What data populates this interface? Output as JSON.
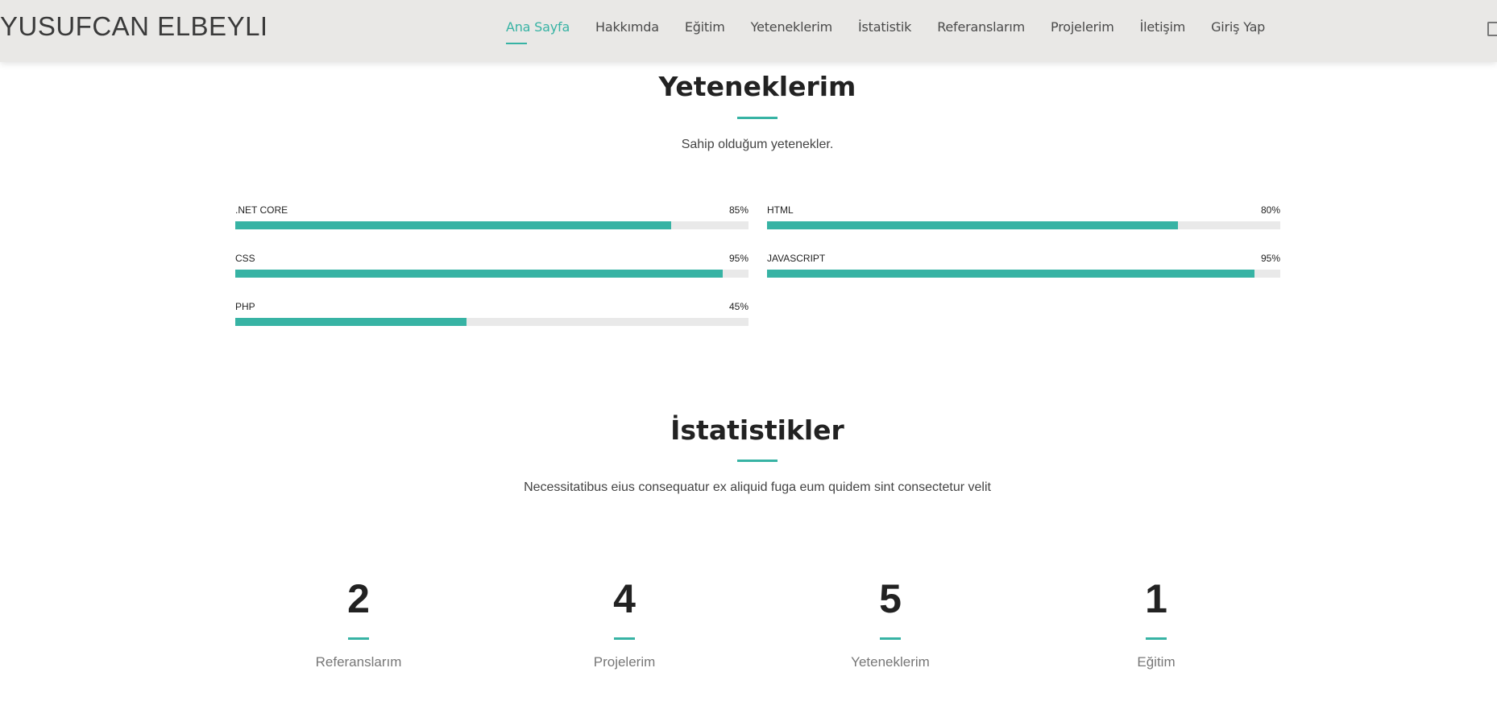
{
  "header": {
    "logo": "YUSUFCAN ELBEYLI",
    "nav": [
      {
        "label": "Ana Sayfa",
        "active": true
      },
      {
        "label": "Hakkımda"
      },
      {
        "label": "Eğitim"
      },
      {
        "label": "Yeteneklerim"
      },
      {
        "label": "İstatistik"
      },
      {
        "label": "Referanslarım"
      },
      {
        "label": "Projelerim"
      },
      {
        "label": "İletişim"
      },
      {
        "label": "Giriş Yap"
      }
    ],
    "corner_icon": "linkedin-icon"
  },
  "skills_section": {
    "title": "Yeteneklerim",
    "subtitle": "Sahip olduğum yetenekler.",
    "skills": [
      {
        "name": ".NET CORE",
        "value_text": "85%",
        "percent": 85
      },
      {
        "name": "HTML",
        "value_text": "80%",
        "percent": 80
      },
      {
        "name": "CSS",
        "value_text": "95%",
        "percent": 95
      },
      {
        "name": "JAVASCRIPT",
        "value_text": "95%",
        "percent": 95
      },
      {
        "name": "PHP",
        "value_text": "45%",
        "percent": 45
      }
    ]
  },
  "stats_section": {
    "title": "İstatistikler",
    "subtitle": "Necessitatibus eius consequatur ex aliquid fuga eum quidem sint consectetur velit",
    "stats": [
      {
        "number": "2",
        "label": "Referanslarım"
      },
      {
        "number": "4",
        "label": "Projelerim"
      },
      {
        "number": "5",
        "label": "Yeteneklerim"
      },
      {
        "number": "1",
        "label": "Eğitim"
      }
    ]
  },
  "colors": {
    "accent": "#37b3a4",
    "header_bg": "#e9e8e6",
    "track": "#e9e9e9"
  }
}
